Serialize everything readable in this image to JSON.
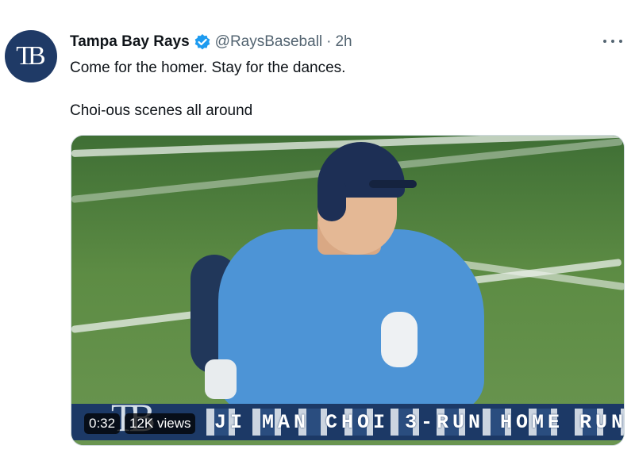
{
  "tweet": {
    "avatar_text": "TB",
    "display_name": "Tampa Bay Rays",
    "verified": true,
    "verified_icon": "verified-badge-icon",
    "handle": "@RaysBaseball",
    "separator": "·",
    "time": "2h",
    "more_icon": "more-options-icon",
    "text_lines": [
      "Come for the homer. Stay for the dances.",
      "Choi-ous scenes all around"
    ]
  },
  "media": {
    "duration": "0:32",
    "views": "12K views",
    "lower_third": "JI MAN CHOI 3-RUN HOME RUN",
    "logo_text": "TB"
  },
  "colors": {
    "verified_blue": "#1d9bf0",
    "rays_navy": "#1f3a66",
    "secondary_text": "#536471"
  }
}
